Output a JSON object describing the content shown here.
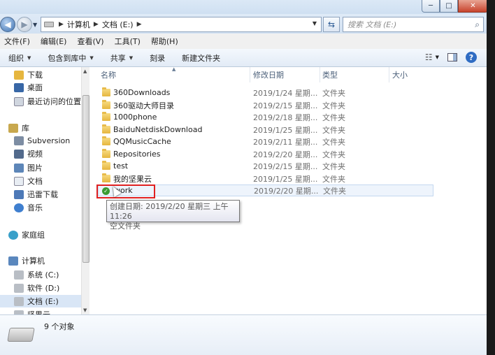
{
  "window": {
    "min_symbol": "─",
    "max_symbol": "□",
    "close_symbol": "✕"
  },
  "address": {
    "crumbs": [
      "计算机",
      "文档 (E:)"
    ],
    "search_placeholder": "搜索 文档 (E:)"
  },
  "menu": [
    "文件(F)",
    "编辑(E)",
    "查看(V)",
    "工具(T)",
    "帮助(H)"
  ],
  "toolbar": {
    "organize": "组织",
    "include_library": "包含到库中",
    "share": "共享",
    "burn": "刻录",
    "new_folder": "新建文件夹",
    "help": "?"
  },
  "nav": {
    "favorites": [
      {
        "label": "下载",
        "icon": "download-folder-icon"
      },
      {
        "label": "桌面",
        "icon": "desktop-icon"
      },
      {
        "label": "最近访问的位置",
        "icon": "recent-places-icon"
      }
    ],
    "libraries_label": "库",
    "libraries": [
      {
        "label": "Subversion",
        "icon": "subversion-icon"
      },
      {
        "label": "视频",
        "icon": "video-library-icon"
      },
      {
        "label": "图片",
        "icon": "pictures-library-icon"
      },
      {
        "label": "文档",
        "icon": "documents-library-icon"
      },
      {
        "label": "迅雷下载",
        "icon": "thunder-download-icon"
      },
      {
        "label": "音乐",
        "icon": "music-library-icon"
      }
    ],
    "homegroup_label": "家庭组",
    "computer_label": "计算机",
    "drives": [
      {
        "label": "系统 (C:)"
      },
      {
        "label": "软件 (D:)"
      },
      {
        "label": "文档 (E:)"
      },
      {
        "label": "坚果云"
      }
    ]
  },
  "columns": [
    "名称",
    "修改日期",
    "类型",
    "大小"
  ],
  "files": [
    {
      "name": "360Downloads",
      "date": "2019/1/24 星期...",
      "type": "文件夹"
    },
    {
      "name": "360驱动大师目录",
      "date": "2019/2/15 星期...",
      "type": "文件夹"
    },
    {
      "name": "1000phone",
      "date": "2019/2/18 星期...",
      "type": "文件夹"
    },
    {
      "name": "BaiduNetdiskDownload",
      "date": "2019/1/25 星期...",
      "type": "文件夹"
    },
    {
      "name": "QQMusicCache",
      "date": "2019/2/11 星期...",
      "type": "文件夹"
    },
    {
      "name": "Repositories",
      "date": "2019/2/20 星期...",
      "type": "文件夹"
    },
    {
      "name": "test",
      "date": "2019/2/15 星期...",
      "type": "文件夹"
    },
    {
      "name": "我的坚果云",
      "date": "2019/1/25 星期...",
      "type": "文件夹"
    },
    {
      "name": "work",
      "date": "2019/2/20 星期...",
      "type": "文件夹"
    }
  ],
  "tooltip": {
    "created": "创建日期: 2019/2/20 星期三 上午 11:26",
    "desc": "空文件夹"
  },
  "status": "9 个对象",
  "colors": {
    "highlight_box": "#e02020",
    "folder": "#e6b63f",
    "title_bg": "#dbe8f6"
  }
}
